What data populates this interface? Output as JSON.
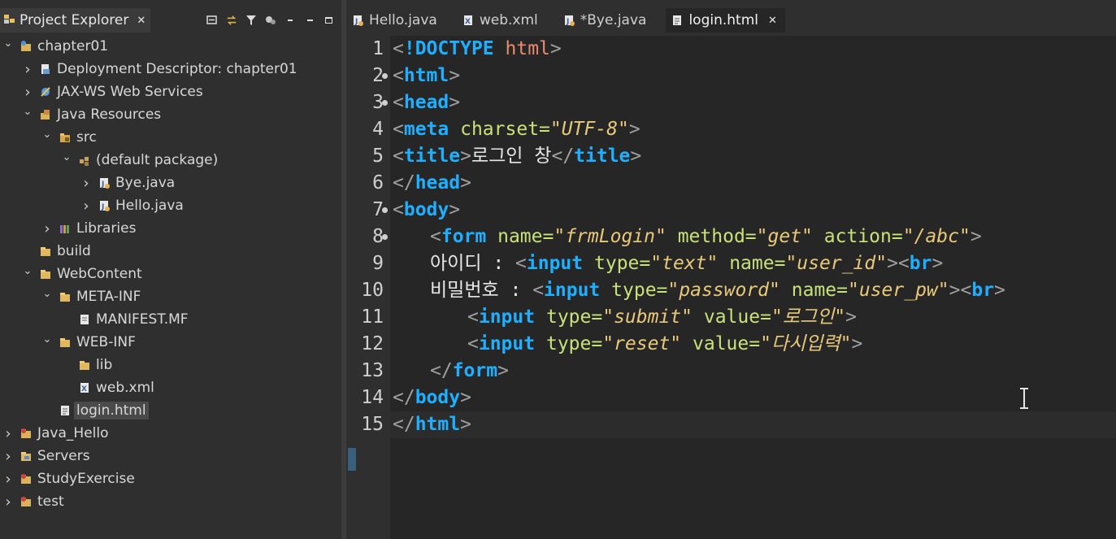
{
  "explorer": {
    "title": "Project Explorer",
    "close": "✕",
    "tree": [
      {
        "label": "chapter01",
        "depth": 0,
        "chev": "down",
        "icon": "web-project-icon"
      },
      {
        "label": "Deployment Descriptor: chapter01",
        "depth": 1,
        "chev": "right",
        "icon": "deployment-descriptor-icon"
      },
      {
        "label": "JAX-WS Web Services",
        "depth": 1,
        "chev": "right",
        "icon": "web-services-icon"
      },
      {
        "label": "Java Resources",
        "depth": 1,
        "chev": "down",
        "icon": "java-resources-icon"
      },
      {
        "label": "src",
        "depth": 2,
        "chev": "down",
        "icon": "source-folder-icon"
      },
      {
        "label": "(default package)",
        "depth": 3,
        "chev": "down",
        "icon": "package-icon"
      },
      {
        "label": "Bye.java",
        "depth": 4,
        "chev": "right",
        "icon": "java-file-icon"
      },
      {
        "label": "Hello.java",
        "depth": 4,
        "chev": "right",
        "icon": "java-file-icon"
      },
      {
        "label": "Libraries",
        "depth": 2,
        "chev": "right",
        "icon": "libraries-icon"
      },
      {
        "label": "build",
        "depth": 1,
        "chev": "none",
        "icon": "folder-icon"
      },
      {
        "label": "WebContent",
        "depth": 1,
        "chev": "down",
        "icon": "folder-icon"
      },
      {
        "label": "META-INF",
        "depth": 2,
        "chev": "down",
        "icon": "folder-icon"
      },
      {
        "label": "MANIFEST.MF",
        "depth": 3,
        "chev": "none",
        "icon": "text-file-icon"
      },
      {
        "label": "WEB-INF",
        "depth": 2,
        "chev": "down",
        "icon": "folder-icon"
      },
      {
        "label": "lib",
        "depth": 3,
        "chev": "none",
        "icon": "folder-icon"
      },
      {
        "label": "web.xml",
        "depth": 3,
        "chev": "none",
        "icon": "xml-file-icon"
      },
      {
        "label": "login.html",
        "depth": 2,
        "chev": "none",
        "icon": "html-file-icon",
        "selected": true
      },
      {
        "label": "Java_Hello",
        "depth": 0,
        "chev": "right",
        "icon": "java-project-icon"
      },
      {
        "label": "Servers",
        "depth": 0,
        "chev": "right",
        "icon": "servers-folder-icon"
      },
      {
        "label": "StudyExercise",
        "depth": 0,
        "chev": "right",
        "icon": "java-project-icon"
      },
      {
        "label": "test",
        "depth": 0,
        "chev": "right",
        "icon": "java-project-icon"
      }
    ]
  },
  "editor": {
    "tabs": [
      {
        "label": "Hello.java",
        "icon": "java-file-icon",
        "active": false
      },
      {
        "label": "web.xml",
        "icon": "xml-file-icon",
        "active": false
      },
      {
        "label": "*Bye.java",
        "icon": "java-file-icon",
        "active": false
      },
      {
        "label": "login.html",
        "icon": "html-file-icon",
        "active": true,
        "close": "✕"
      }
    ],
    "current_line": 15,
    "lines": [
      {
        "n": "1",
        "fold": false,
        "indent": 0,
        "tokens": [
          [
            "br",
            "<"
          ],
          [
            "doctype",
            "!DOCTYPE"
          ],
          [
            "text",
            " "
          ],
          [
            "dthtml",
            "html"
          ],
          [
            "br",
            ">"
          ]
        ]
      },
      {
        "n": "2",
        "fold": true,
        "indent": 0,
        "tokens": [
          [
            "br",
            "<"
          ],
          [
            "tag",
            "html"
          ],
          [
            "br",
            ">"
          ]
        ]
      },
      {
        "n": "3",
        "fold": true,
        "indent": 0,
        "tokens": [
          [
            "br",
            "<"
          ],
          [
            "tag",
            "head"
          ],
          [
            "br",
            ">"
          ]
        ]
      },
      {
        "n": "4",
        "fold": false,
        "indent": 0,
        "tokens": [
          [
            "br",
            "<"
          ],
          [
            "tag",
            "meta"
          ],
          [
            "text",
            " "
          ],
          [
            "attr",
            "charset"
          ],
          [
            "eq",
            "="
          ],
          [
            "val",
            "\"UTF-8\""
          ],
          [
            "br",
            ">"
          ]
        ]
      },
      {
        "n": "5",
        "fold": false,
        "indent": 0,
        "tokens": [
          [
            "br",
            "<"
          ],
          [
            "tag",
            "title"
          ],
          [
            "br",
            ">"
          ],
          [
            "text",
            "로그인 창"
          ],
          [
            "br",
            "</"
          ],
          [
            "tag",
            "title"
          ],
          [
            "br",
            ">"
          ]
        ]
      },
      {
        "n": "6",
        "fold": false,
        "indent": 0,
        "tokens": [
          [
            "br",
            "</"
          ],
          [
            "tag",
            "head"
          ],
          [
            "br",
            ">"
          ]
        ]
      },
      {
        "n": "7",
        "fold": true,
        "indent": 0,
        "tokens": [
          [
            "br",
            "<"
          ],
          [
            "tag",
            "body"
          ],
          [
            "br",
            ">"
          ]
        ]
      },
      {
        "n": "8",
        "fold": true,
        "indent": 1,
        "tokens": [
          [
            "br",
            "<"
          ],
          [
            "tag",
            "form"
          ],
          [
            "text",
            " "
          ],
          [
            "attr",
            "name"
          ],
          [
            "eq",
            "="
          ],
          [
            "val",
            "\"frmLogin\""
          ],
          [
            "text",
            " "
          ],
          [
            "attr",
            "method"
          ],
          [
            "eq",
            "="
          ],
          [
            "val",
            "\"get\""
          ],
          [
            "text",
            " "
          ],
          [
            "attr",
            "action"
          ],
          [
            "eq",
            "="
          ],
          [
            "val",
            "\"/abc\""
          ],
          [
            "br",
            ">"
          ]
        ]
      },
      {
        "n": "9",
        "fold": false,
        "indent": 1,
        "tokens": [
          [
            "text",
            "아이디 : "
          ],
          [
            "br",
            "<"
          ],
          [
            "tag",
            "input"
          ],
          [
            "text",
            " "
          ],
          [
            "attr",
            "type"
          ],
          [
            "eq",
            "="
          ],
          [
            "val",
            "\"text\""
          ],
          [
            "text",
            " "
          ],
          [
            "attr",
            "name"
          ],
          [
            "eq",
            "="
          ],
          [
            "val",
            "\"user_id\""
          ],
          [
            "br",
            ">"
          ],
          [
            "br",
            "<"
          ],
          [
            "tag",
            "br"
          ],
          [
            "br",
            ">"
          ]
        ]
      },
      {
        "n": "10",
        "fold": false,
        "indent": 1,
        "tokens": [
          [
            "text",
            "비밀번호 : "
          ],
          [
            "br",
            "<"
          ],
          [
            "tag",
            "input"
          ],
          [
            "text",
            " "
          ],
          [
            "attr",
            "type"
          ],
          [
            "eq",
            "="
          ],
          [
            "val",
            "\"password\""
          ],
          [
            "text",
            " "
          ],
          [
            "attr",
            "name"
          ],
          [
            "eq",
            "="
          ],
          [
            "val",
            "\"user_pw\""
          ],
          [
            "br",
            ">"
          ],
          [
            "br",
            "<"
          ],
          [
            "tag",
            "br"
          ],
          [
            "br",
            ">"
          ]
        ]
      },
      {
        "n": "11",
        "fold": false,
        "indent": 2,
        "tokens": [
          [
            "br",
            "<"
          ],
          [
            "tag",
            "input"
          ],
          [
            "text",
            " "
          ],
          [
            "attr",
            "type"
          ],
          [
            "eq",
            "="
          ],
          [
            "val",
            "\"submit\""
          ],
          [
            "text",
            " "
          ],
          [
            "attr",
            "value"
          ],
          [
            "eq",
            "="
          ],
          [
            "val",
            "\"로그인\""
          ],
          [
            "br",
            ">"
          ]
        ]
      },
      {
        "n": "12",
        "fold": false,
        "indent": 2,
        "tokens": [
          [
            "br",
            "<"
          ],
          [
            "tag",
            "input"
          ],
          [
            "text",
            " "
          ],
          [
            "attr",
            "type"
          ],
          [
            "eq",
            "="
          ],
          [
            "val",
            "\"reset\""
          ],
          [
            "text",
            " "
          ],
          [
            "attr",
            "value"
          ],
          [
            "eq",
            "="
          ],
          [
            "val",
            "\"다시입력\""
          ],
          [
            "br",
            ">"
          ]
        ]
      },
      {
        "n": "13",
        "fold": false,
        "indent": 1,
        "tokens": [
          [
            "br",
            "</"
          ],
          [
            "tag",
            "form"
          ],
          [
            "br",
            ">"
          ]
        ]
      },
      {
        "n": "14",
        "fold": false,
        "indent": 0,
        "tokens": [
          [
            "br",
            "</"
          ],
          [
            "tag",
            "body"
          ],
          [
            "br",
            ">"
          ]
        ]
      },
      {
        "n": "15",
        "fold": false,
        "indent": 0,
        "tokens": [
          [
            "br",
            "</"
          ],
          [
            "tag",
            "html"
          ],
          [
            "br",
            ">"
          ]
        ]
      }
    ]
  }
}
